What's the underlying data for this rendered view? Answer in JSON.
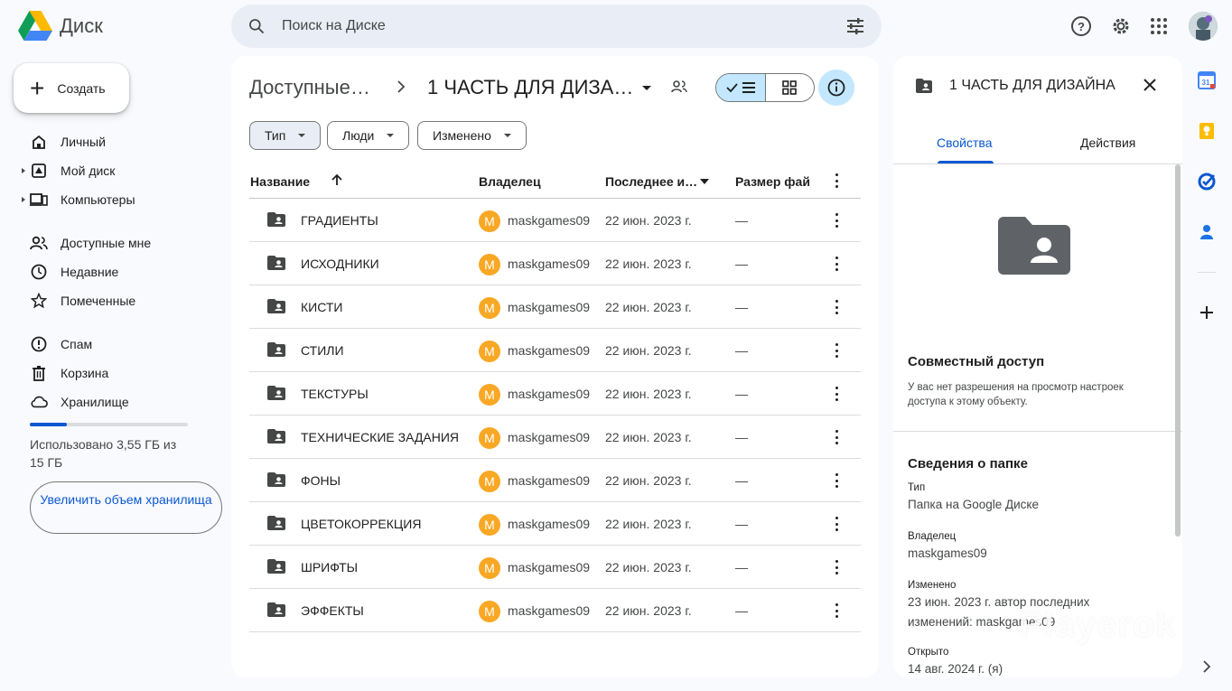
{
  "app": {
    "title": "Диск"
  },
  "search": {
    "placeholder": "Поиск на Диске"
  },
  "sidebar": {
    "create_label": "Создать",
    "items": [
      {
        "label": "Личный",
        "icon": "home-icon"
      },
      {
        "label": "Мой диск",
        "icon": "drive-icon"
      },
      {
        "label": "Компьютеры",
        "icon": "computer-icon"
      },
      {
        "label": "Доступные мне",
        "icon": "people-icon"
      },
      {
        "label": "Недавние",
        "icon": "clock-icon"
      },
      {
        "label": "Помеченные",
        "icon": "star-icon"
      },
      {
        "label": "Спам",
        "icon": "spam-icon"
      },
      {
        "label": "Корзина",
        "icon": "trash-icon"
      },
      {
        "label": "Хранилище",
        "icon": "cloud-icon"
      }
    ],
    "storage_used_fraction": 0.237,
    "storage_text": "Использовано 3,55 ГБ из 15 ГБ",
    "upgrade_label": "Увеличить объем хранилища"
  },
  "main": {
    "breadcrumb_parent": "Доступные…",
    "breadcrumb_current": "1 ЧАСТЬ ДЛЯ ДИЗА…",
    "filters": [
      "Тип",
      "Люди",
      "Изменено"
    ],
    "columns": {
      "name": "Название",
      "owner": "Владелец",
      "modified": "Последнее и…",
      "size": "Размер фай"
    },
    "rows": [
      {
        "name": "ГРАДИЕНТЫ",
        "owner_initial": "M",
        "owner": "maskgames09",
        "date": "22 июн. 2023 г.",
        "size": "—"
      },
      {
        "name": "ИСХОДНИКИ",
        "owner_initial": "M",
        "owner": "maskgames09",
        "date": "22 июн. 2023 г.",
        "size": "—"
      },
      {
        "name": "КИСТИ",
        "owner_initial": "M",
        "owner": "maskgames09",
        "date": "22 июн. 2023 г.",
        "size": "—"
      },
      {
        "name": "СТИЛИ",
        "owner_initial": "M",
        "owner": "maskgames09",
        "date": "22 июн. 2023 г.",
        "size": "—"
      },
      {
        "name": "ТЕКСТУРЫ",
        "owner_initial": "M",
        "owner": "maskgames09",
        "date": "22 июн. 2023 г.",
        "size": "—"
      },
      {
        "name": "ТЕХНИЧЕСКИЕ ЗАДАНИЯ",
        "owner_initial": "M",
        "owner": "maskgames09",
        "date": "22 июн. 2023 г.",
        "size": "—"
      },
      {
        "name": "ФОНЫ",
        "owner_initial": "M",
        "owner": "maskgames09",
        "date": "22 июн. 2023 г.",
        "size": "—"
      },
      {
        "name": "ЦВЕТОКОРРЕКЦИЯ",
        "owner_initial": "M",
        "owner": "maskgames09",
        "date": "22 июн. 2023 г.",
        "size": "—"
      },
      {
        "name": "ШРИФТЫ",
        "owner_initial": "M",
        "owner": "maskgames09",
        "date": "22 июн. 2023 г.",
        "size": "—"
      },
      {
        "name": "ЭФФЕКТЫ",
        "owner_initial": "M",
        "owner": "maskgames09",
        "date": "22 июн. 2023 г.",
        "size": "—"
      }
    ]
  },
  "details": {
    "title": "1 ЧАСТЬ ДЛЯ ДИЗАЙНА",
    "tabs": [
      "Свойства",
      "Действия"
    ],
    "sharing_heading": "Совместный доступ",
    "sharing_text": "У вас нет разрешения на просмотр настроек доступа к этому объекту.",
    "info_heading": "Сведения о папке",
    "fields": [
      {
        "label": "Тип",
        "value": "Папка на Google Диске"
      },
      {
        "label": "Владелец",
        "value": "maskgames09"
      },
      {
        "label": "Изменено",
        "value": "23 июн. 2023 г. автор последних изменений: maskgames09"
      },
      {
        "label": "Открыто",
        "value": "14 авг. 2024 г. (я)"
      }
    ]
  },
  "watermark": "Playerok",
  "colors": {
    "accent": "#0b57d0",
    "selected": "#c2e7ff",
    "owner_avatar": "#f9a825"
  }
}
